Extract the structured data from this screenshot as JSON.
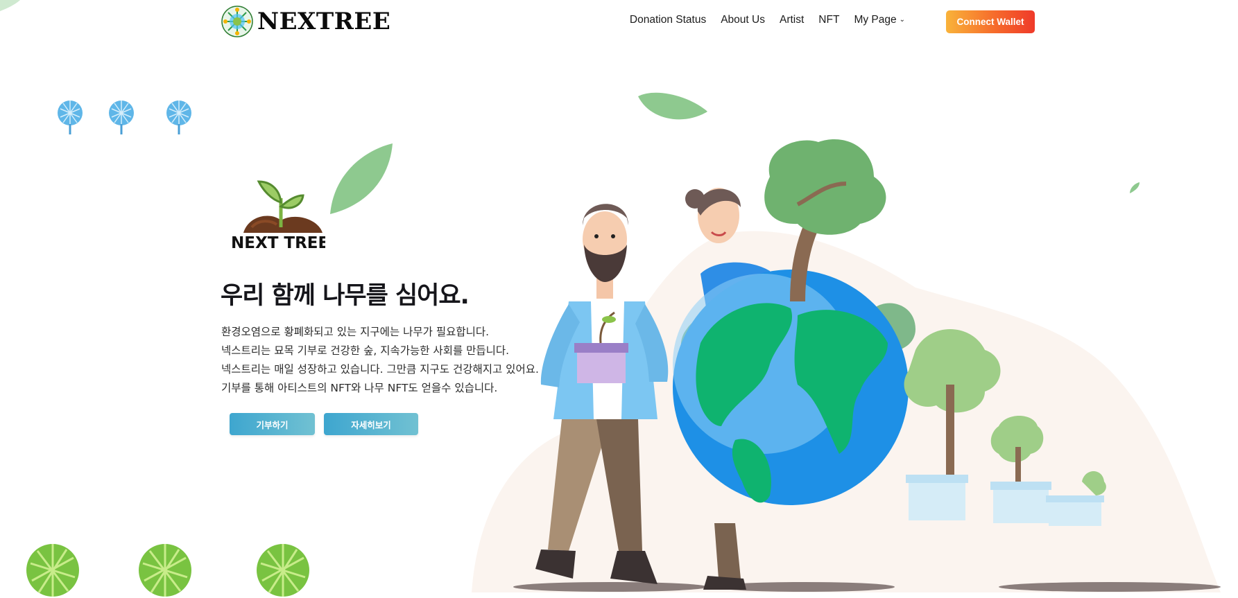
{
  "brand": {
    "name": "NEXTREE",
    "logo_text": "NEXT TREE"
  },
  "nav": {
    "items": [
      {
        "label": "Donation Status"
      },
      {
        "label": "About Us"
      },
      {
        "label": "Artist"
      },
      {
        "label": "NFT"
      },
      {
        "label": "My Page"
      }
    ],
    "wallet_label": "Connect Wallet"
  },
  "hero": {
    "headline": "우리 함께 나무를 심어요.",
    "lines": [
      "환경오염으로 황폐화되고 있는 지구에는 나무가 필요합니다.",
      "넥스트리는 묘목 기부로 건강한 숲, 지속가능한 사회를 만듭니다.",
      "넥스트리는 매일 성장하고 있습니다. 그만큼 지구도 건강해지고 있어요.",
      "기부를 통해 아티스트의 NFT와 나무 NFT도 얻을수 있습니다."
    ],
    "donate_label": "기부하기",
    "detail_label": "자세히보기"
  },
  "colors": {
    "wallet_gradient": [
      "#f9b33a",
      "#ef3a2a"
    ],
    "hero_button": "#3ea6cf",
    "leaf_green": "#8ec98f",
    "globe_blue": "#1e90e6",
    "land_green": "#0fb36f"
  },
  "icons": [
    "brand-logo-icon",
    "chevron-down-icon",
    "blue-tree-icon",
    "green-tree-icon",
    "sprout-logo-icon"
  ]
}
